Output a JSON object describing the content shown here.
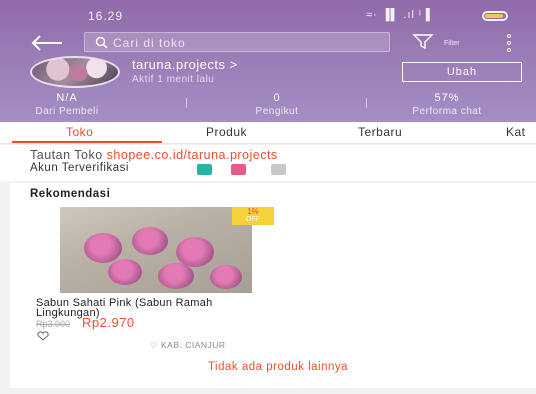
{
  "status_bar": {
    "time": "16.29",
    "icons_text": "≈· ▐▌ .ıl ᴵ▐"
  },
  "search": {
    "placeholder": "Cari di toko"
  },
  "filter": {
    "label": "Filter"
  },
  "shop": {
    "name": "taruna.projects >",
    "status": "Aktif 1 menit lalu",
    "follow_label": "Ubah"
  },
  "stats": [
    {
      "value": "N/A",
      "label": "Dari Pembeli"
    },
    {
      "value": "0",
      "label": "Pengikut"
    },
    {
      "value": "57%",
      "label": "Performa chat"
    }
  ],
  "tabs": [
    {
      "label": "Toko",
      "active": true
    },
    {
      "label": "Produk",
      "active": false
    },
    {
      "label": "Terbaru",
      "active": false
    },
    {
      "label": "Kat",
      "active": false
    }
  ],
  "info": {
    "link_label": "Tautan Toko",
    "link_url": "shopee.co.id/taruna.projects",
    "verified_label": "Akun Terverifikasi",
    "badge_colors": [
      "#26b5a3",
      "#e85a8c",
      "#c8c8c8"
    ]
  },
  "recommendation": {
    "title": "Rekomendasi",
    "product": {
      "name": "Sabun Sahati Pink (Sabun Ramah Lingkungan)",
      "old_price": "Rp3.000",
      "price": "Rp2.970",
      "discount_pct": "1%",
      "discount_label": "OFF",
      "location": "KAB. CIANJUR"
    },
    "no_more": "Tidak ada produk lainnya"
  },
  "colors": {
    "accent": "#ee4d2d",
    "header": "#9a7cb6",
    "discount": "#f6d23a"
  }
}
